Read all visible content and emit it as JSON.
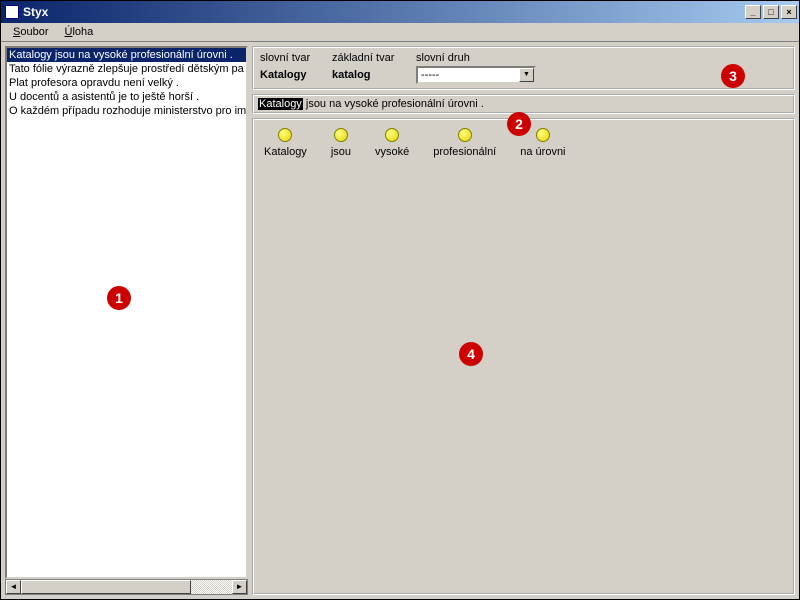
{
  "window": {
    "title": "Styx"
  },
  "menu": {
    "soubor": "Soubor",
    "uloha": "Úloha",
    "soubor_u": "S",
    "uloha_u": "Ú"
  },
  "sentences": [
    "Katalogy jsou na vysoké profesionální úrovni .",
    "Tato fólie výrazně zlepšuje prostředí dětským pa",
    "Plat profesora opravdu není velký .",
    "U docentů a asistentů je to ještě horší .",
    "O každém případu rozhoduje ministerstvo pro im"
  ],
  "selected_index": 0,
  "morph": {
    "h_slovni_tvar": "slovní tvar",
    "h_zakladni_tvar": "základní tvar",
    "h_slovni_druh": "slovní druh",
    "slovni_tvar": "Katalogy",
    "zakladni_tvar": "katalog",
    "slovni_druh": "-----"
  },
  "current_sentence": {
    "highlight": "Katalogy",
    "rest": " jsou na vysoké profesionální úrovni ."
  },
  "tokens": [
    {
      "label": "Katalogy"
    },
    {
      "label": "jsou"
    },
    {
      "label": "vysoké"
    },
    {
      "label": "profesionální"
    },
    {
      "label": "na úrovni"
    }
  ],
  "markers": {
    "m1": "1",
    "m2": "2",
    "m3": "3",
    "m4": "4"
  }
}
